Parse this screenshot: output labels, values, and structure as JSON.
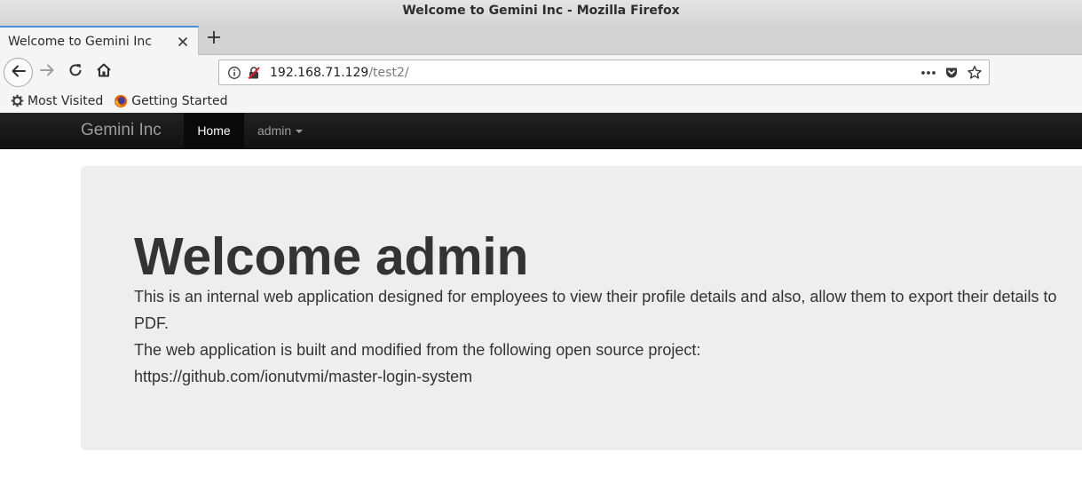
{
  "window": {
    "title": "Welcome to Gemini Inc - Mozilla Firefox"
  },
  "tabs": [
    {
      "label": "Welcome to Gemini Inc",
      "active": true
    }
  ],
  "urlbar": {
    "host": "192.168.71.129",
    "path": "/test2/"
  },
  "bookmarks": [
    {
      "label": "Most Visited",
      "icon": "gear-icon"
    },
    {
      "label": "Getting Started",
      "icon": "firefox-icon"
    }
  ],
  "site": {
    "brand": "Gemini Inc",
    "nav": {
      "home": "Home",
      "admin": "admin"
    }
  },
  "jumbotron": {
    "heading": "Welcome admin",
    "intro": "This is an internal web application designed for employees to view their profile details and also, allow them to export their details to PDF.",
    "source_line": "The web application is built and modified from the following open source project:",
    "source_url": "https://github.com/ionutvmi/master-login-system"
  },
  "colors": {
    "tab_accent": "#4a90d9",
    "navbar_bg": "#222222",
    "jumbotron_bg": "#eeeeee",
    "text": "#333333"
  }
}
